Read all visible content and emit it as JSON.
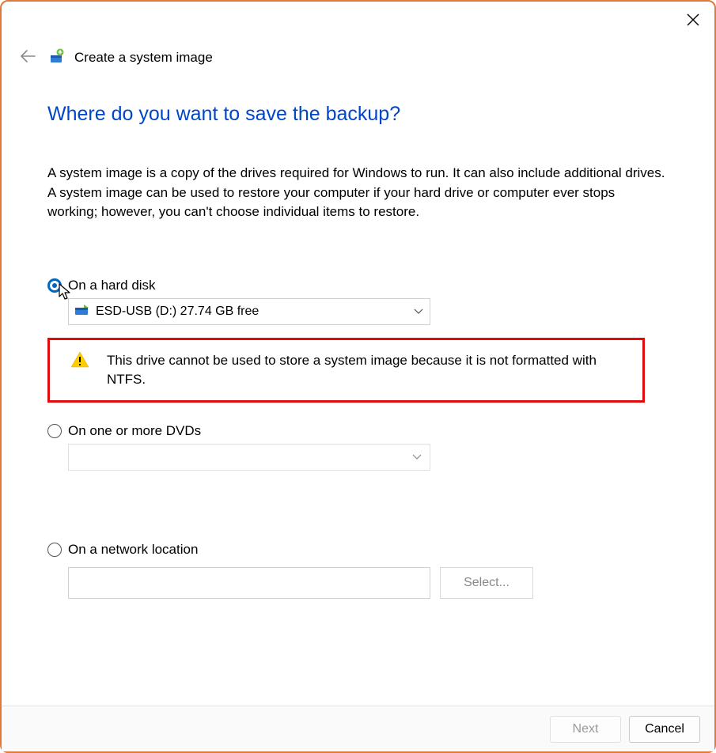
{
  "window": {
    "title": "Create a system image"
  },
  "page": {
    "heading": "Where do you want to save the backup?",
    "description": "A system image is a copy of the drives required for Windows to run. It can also include additional drives. A system image can be used to restore your computer if your hard drive or computer ever stops working; however, you can't choose individual items to restore."
  },
  "options": {
    "hard_disk": {
      "label": "On a hard disk",
      "selected": true,
      "drive": "ESD-USB (D:)  27.74 GB free",
      "warning": "This drive cannot be used to store a system image because it is not formatted with NTFS."
    },
    "dvd": {
      "label": "On one or more DVDs",
      "selected": false
    },
    "network": {
      "label": "On a network location",
      "selected": false,
      "select_button": "Select..."
    }
  },
  "footer": {
    "next": "Next",
    "cancel": "Cancel"
  }
}
